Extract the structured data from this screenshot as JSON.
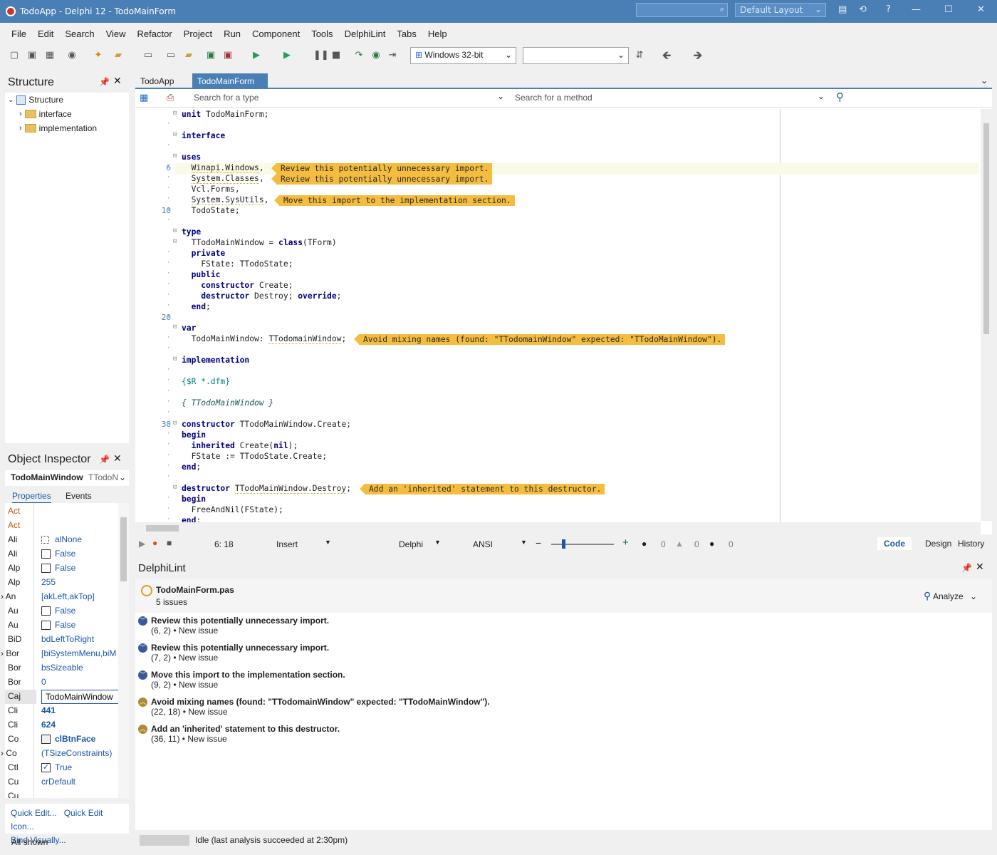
{
  "window": {
    "title": "TodoApp - Delphi 12 - TodoMainForm",
    "layout": "Default Layout"
  },
  "menu": [
    "File",
    "Edit",
    "Search",
    "View",
    "Refactor",
    "Project",
    "Run",
    "Component",
    "Tools",
    "DelphiLint",
    "Tabs",
    "Help"
  ],
  "toolbar": {
    "platform": "Windows 32-bit",
    "config": ""
  },
  "structure": {
    "title": "Structure",
    "root": "Structure",
    "items": [
      "interface",
      "implementation"
    ]
  },
  "object_inspector": {
    "title": "Object Inspector",
    "component": "TodoMainWindow",
    "component_type": "TTodoN",
    "tabs": [
      "Properties",
      "Events"
    ],
    "rows": [
      {
        "name": "Act",
        "value": ""
      },
      {
        "name": "Act",
        "value": ""
      },
      {
        "name": "Ali",
        "value": "alNone"
      },
      {
        "name": "Ali",
        "value": "False"
      },
      {
        "name": "Alp",
        "value": "False"
      },
      {
        "name": "Alp",
        "value": "255"
      },
      {
        "name": "An",
        "value": "[akLeft,akTop]"
      },
      {
        "name": "Au",
        "value": "False"
      },
      {
        "name": "Au",
        "value": "False"
      },
      {
        "name": "BiD",
        "value": "bdLeftToRight"
      },
      {
        "name": "Bor",
        "value": "[biSystemMenu,biM"
      },
      {
        "name": "Bor",
        "value": "bsSizeable"
      },
      {
        "name": "Bor",
        "value": "0"
      },
      {
        "name": "Caj",
        "value": "TodoMainWindow"
      },
      {
        "name": "Cli",
        "value": "441"
      },
      {
        "name": "Cli",
        "value": "624"
      },
      {
        "name": "Co",
        "value": "clBtnFace"
      },
      {
        "name": "Co",
        "value": "(TSizeConstraints)"
      },
      {
        "name": "Ctl",
        "value": "True"
      },
      {
        "name": "Cu",
        "value": "crDefault"
      },
      {
        "name": "Cu",
        "value": ""
      }
    ],
    "links": [
      "Quick Edit...",
      "Quick Edit Icon...",
      "Bind Visually..."
    ],
    "footer": "All shown"
  },
  "editor": {
    "tabs": [
      "TodoApp",
      "TodoMainForm"
    ],
    "search_type_placeholder": "Search for a type",
    "search_method_placeholder": "Search for a method",
    "line_numbers": [
      {
        "n": "6",
        "row": 5
      },
      {
        "n": "10",
        "row": 9
      },
      {
        "n": "20",
        "row": 19
      },
      {
        "n": "30",
        "row": 29
      }
    ],
    "hints": [
      {
        "row": 5,
        "text": "Review this potentially unnecessary import."
      },
      {
        "row": 6,
        "text": "Review this potentially unnecessary import."
      },
      {
        "row": 8,
        "text": "Move this import to the implementation section."
      },
      {
        "row": 21,
        "text": "Avoid mixing names (found: \"TTodomainWindow\" expected: \"TTodoMainWindow\")."
      },
      {
        "row": 35,
        "text": "Add an 'inherited' statement to this destructor."
      }
    ]
  },
  "status": {
    "position": "6: 18",
    "mode": "Insert",
    "language": "Delphi",
    "encoding": "ANSI",
    "errors": "0",
    "warnings": "0",
    "infos": "0",
    "views": [
      "Code",
      "Design",
      "History"
    ]
  },
  "delphilint": {
    "title": "DelphiLint",
    "file": "TodoMainForm.pas",
    "count": "5 issues",
    "analyze": "Analyze",
    "issues": [
      {
        "title": "Review this potentially unnecessary import.",
        "sub": "(6, 2) • New issue",
        "kind": "info"
      },
      {
        "title": "Review this potentially unnecessary import.",
        "sub": "(7, 2) • New issue",
        "kind": "info"
      },
      {
        "title": "Move this import to the implementation section.",
        "sub": "(9, 2) • New issue",
        "kind": "info"
      },
      {
        "title": "Avoid mixing names (found: \"TTodomainWindow\" expected: \"TTodoMainWindow\").",
        "sub": "(22, 18) • New issue",
        "kind": "warn"
      },
      {
        "title": "Add an 'inherited' statement to this destructor.",
        "sub": "(36, 11) • New issue",
        "kind": "warn"
      }
    ],
    "status": "Idle (last analysis succeeded at 2:30pm)"
  },
  "colors": {
    "titlebar": "#4a7fb5",
    "hint": "#f5bd3f",
    "keyword": "#000080",
    "link": "#1a56a8"
  }
}
